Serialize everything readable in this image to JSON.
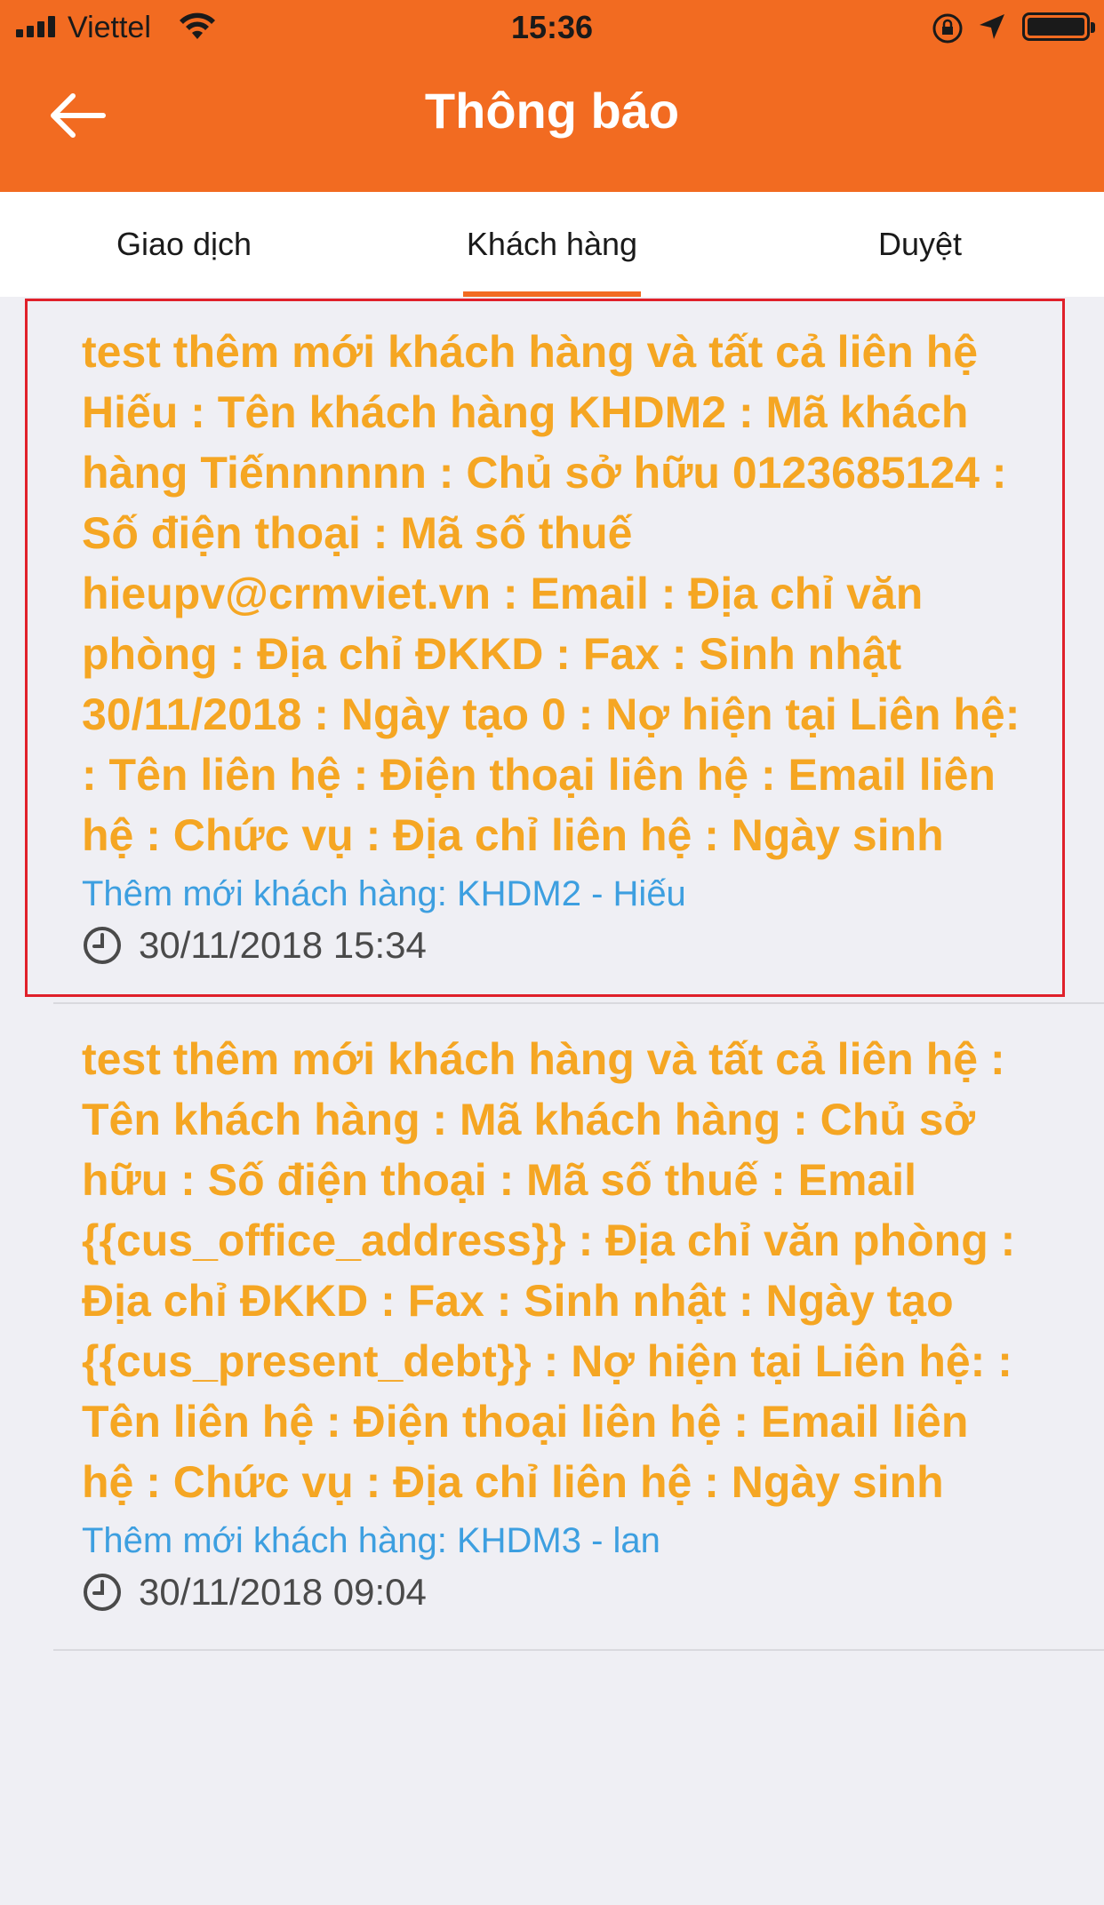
{
  "status_bar": {
    "carrier": "Viettel",
    "time": "15:36"
  },
  "header": {
    "title": "Thông báo"
  },
  "tabs": [
    {
      "label": "Giao dịch",
      "active": false
    },
    {
      "label": "Khách hàng",
      "active": true
    },
    {
      "label": "Duyệt",
      "active": false
    }
  ],
  "notifications": [
    {
      "message": "test thêm mới khách hàng và tất cả liên hệ Hiếu : Tên khách hàng KHDM2 : Mã khách hàng Tiếnnnnnn : Chủ sở hữu 0123685124 : Số điện thoại : Mã số thuế hieupv@crmviet.vn : Email : Địa chỉ văn phòng : Địa chỉ ĐKKD : Fax : Sinh nhật 30/11/2018 : Ngày tạo 0 : Nợ hiện tại Liên hệ: : Tên liên hệ : Điện thoại liên hệ : Email liên hệ : Chức vụ : Địa chỉ liên hệ : Ngày sinh",
      "subtitle": "Thêm mới khách hàng: KHDM2 - Hiếu",
      "time": "30/11/2018 15:34"
    },
    {
      "message": "test thêm mới khách hàng và tất cả liên hệ : Tên khách hàng : Mã khách hàng : Chủ sở hữu : Số điện thoại : Mã số thuế : Email {{cus_office_address}} : Địa chỉ văn phòng : Địa chỉ ĐKKD : Fax : Sinh nhật : Ngày tạo {{cus_present_debt}} : Nợ hiện tại Liên hệ: : Tên liên hệ : Điện thoại liên hệ : Email liên hệ : Chức vụ : Địa chỉ liên hệ : Ngày sinh",
      "subtitle": "Thêm mới khách hàng: KHDM3 - lan",
      "time": "30/11/2018 09:04"
    }
  ],
  "colors": {
    "header_bg": "#f26b21",
    "message": "#f5a623",
    "subtitle": "#3d9fe0",
    "highlight_border": "#e0202a"
  }
}
